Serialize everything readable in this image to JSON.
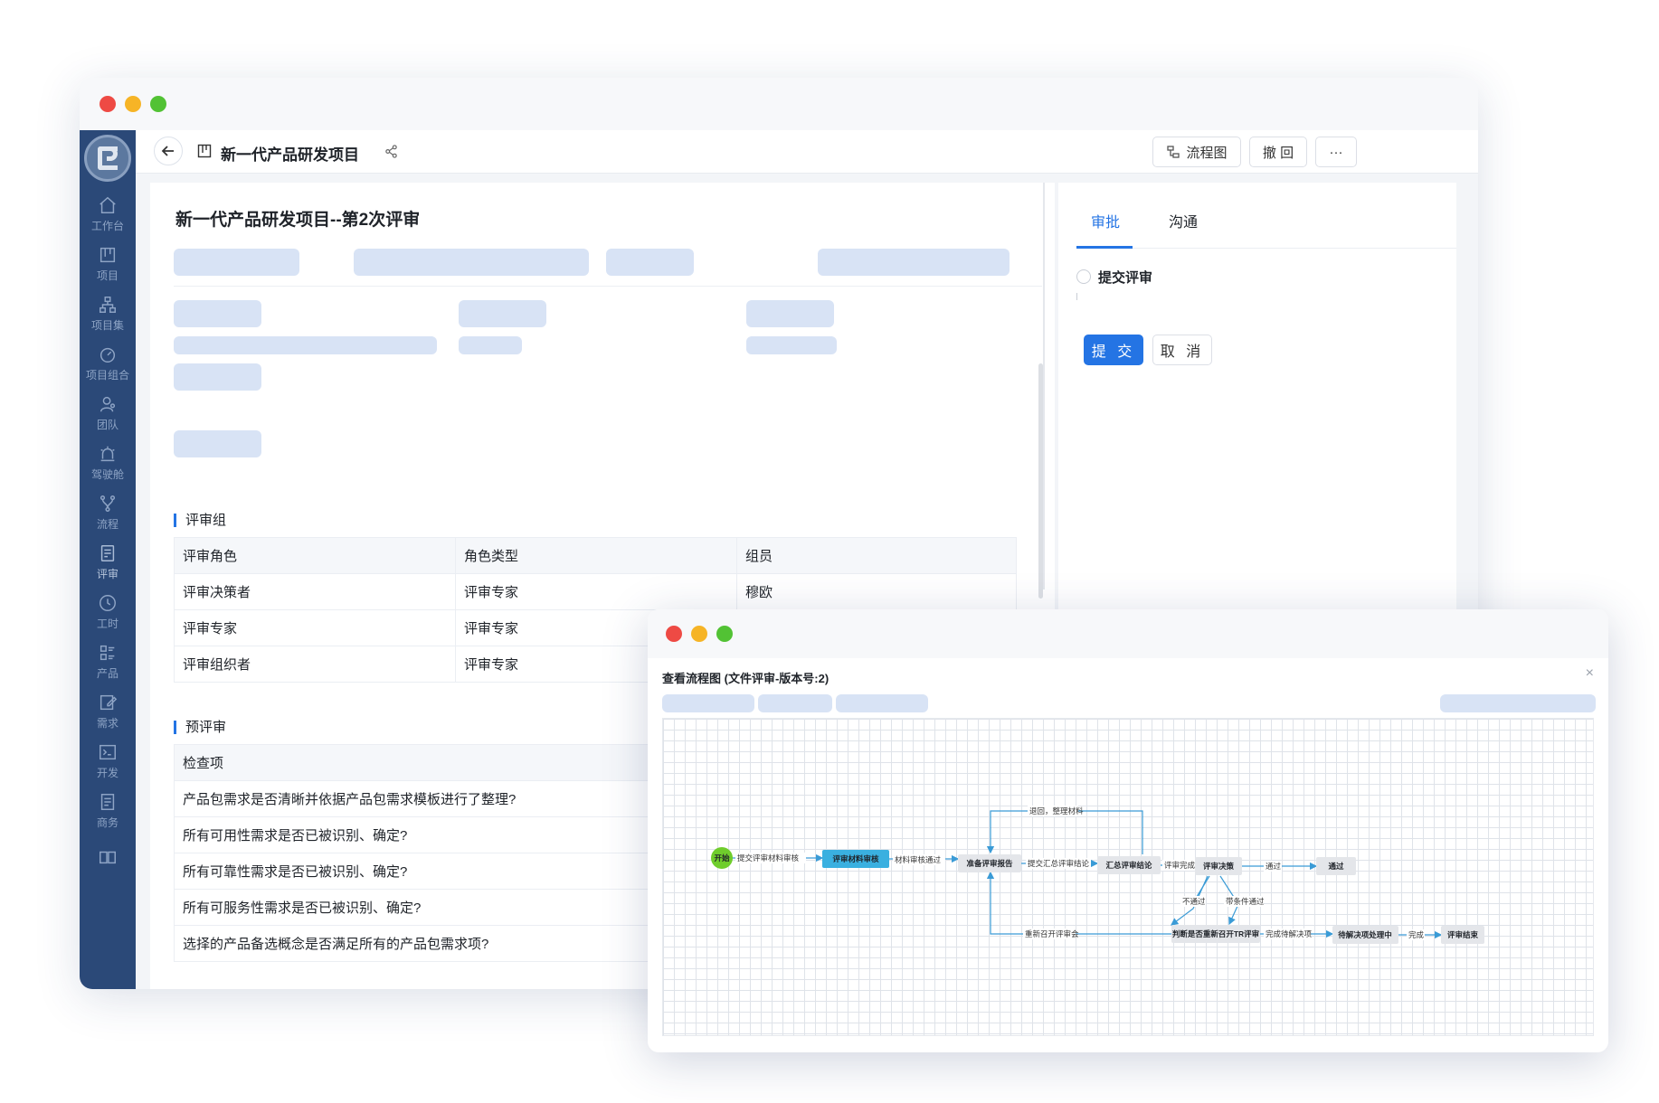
{
  "main_window": {
    "project_title": "新一代产品研发项目",
    "review_title": "新一代产品研发项目--第2次评审",
    "toolbar": {
      "flowchart_label": "流程图",
      "withdraw_label": "撤 回",
      "more_label": "···"
    }
  },
  "sidebar": {
    "items": [
      {
        "label": "工作台",
        "icon": "home-icon"
      },
      {
        "label": "项目",
        "icon": "board-icon"
      },
      {
        "label": "项目集",
        "icon": "hierarchy-icon"
      },
      {
        "label": "项目组合",
        "icon": "gauge-icon"
      },
      {
        "label": "团队",
        "icon": "team-icon"
      },
      {
        "label": "驾驶舱",
        "icon": "alarm-icon"
      },
      {
        "label": "流程",
        "icon": "branch-icon"
      },
      {
        "label": "评审",
        "icon": "review-icon"
      },
      {
        "label": "工时",
        "icon": "clock-icon"
      },
      {
        "label": "产品",
        "icon": "product-icon"
      },
      {
        "label": "需求",
        "icon": "edit-icon"
      },
      {
        "label": "开发",
        "icon": "terminal-icon"
      },
      {
        "label": "商务",
        "icon": "business-icon"
      }
    ]
  },
  "review_group": {
    "section_title": "评审组",
    "columns": [
      "评审角色",
      "角色类型",
      "组员"
    ],
    "rows": [
      [
        "评审决策者",
        "评审专家",
        "穆欧"
      ],
      [
        "评审专家",
        "评审专家",
        ""
      ],
      [
        "评审组织者",
        "评审专家",
        ""
      ]
    ]
  },
  "pre_review": {
    "section_title": "预评审",
    "column": "检查项",
    "items": [
      "产品包需求是否清晰并依据产品包需求模板进行了整理?",
      "所有可用性需求是否已被识别、确定?",
      "所有可靠性需求是否已被识别、确定?",
      "所有可服务性需求是否已被识别、确定?",
      "选择的产品备选概念是否满足所有的产品包需求项?"
    ]
  },
  "right_panel": {
    "tabs": [
      "审批",
      "沟通"
    ],
    "radio_label": "提交评审",
    "submit_label": "提 交",
    "cancel_label": "取 消"
  },
  "modal": {
    "title": "查看流程图 (文件评审-版本号:2)",
    "close": "×",
    "flow": {
      "nodes": {
        "start": "开始",
        "n1": "评审材料审核",
        "n2": "准备评审报告",
        "n3": "汇总评审结论",
        "n4": "评审决策",
        "n5": "通过",
        "n6": "判断是否重新召开TR评审",
        "n7": "待解决项处理中",
        "n8": "评审结束"
      },
      "edges": {
        "e1": "提交评审材料审核",
        "e2": "材料审核通过",
        "e3": "提交汇总评审结论",
        "e4": "评审完成",
        "e5": "通过",
        "e6": "退回，整理材料",
        "e7": "不通过",
        "e8": "带条件通过",
        "e9": "重新召开评审会",
        "e10": "完成待解决项",
        "e11": "完成"
      }
    }
  },
  "colors": {
    "accent": "#2474e4",
    "sidebar_bg": "#2b4978",
    "placeholder": "#d8e3f5",
    "start_node": "#6fcd2c",
    "active_node": "#3ab0e0"
  }
}
